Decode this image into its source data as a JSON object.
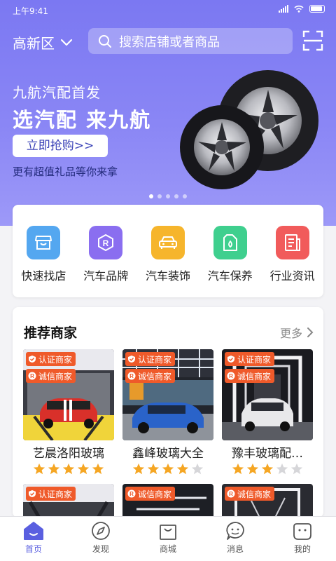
{
  "status": {
    "time": "上午9:41"
  },
  "header": {
    "city": "高新区",
    "search_placeholder": "搜索店铺或者商品"
  },
  "banner": {
    "subtitle": "九航汽配首发",
    "title": "选汽配 来九航",
    "button_label": "立即抢购>>",
    "note": "更有超值礼品等你来拿",
    "slides": 5,
    "active_slide": 0
  },
  "quick_links": [
    {
      "label": "快速找店",
      "icon": "store-icon",
      "color": "#54a7f0"
    },
    {
      "label": "汽车品牌",
      "icon": "brand-icon",
      "color": "#8a6ef0"
    },
    {
      "label": "汽车装饰",
      "icon": "car-icon",
      "color": "#f6b52c"
    },
    {
      "label": "汽车保养",
      "icon": "oil-icon",
      "color": "#3fcf8e"
    },
    {
      "label": "行业资讯",
      "icon": "news-icon",
      "color": "#f15b5b"
    }
  ],
  "recommended": {
    "title": "推荐商家",
    "more_label": "更多",
    "badges": {
      "certified": "认证商家",
      "trusted": "诚信商家"
    },
    "shops": [
      {
        "name": "艺晨洛阳玻璃",
        "rating": 5,
        "car_color": "#d9302a"
      },
      {
        "name": "鑫峰玻璃大全",
        "rating": 4,
        "car_color": "#2a63c9"
      },
      {
        "name": "豫丰玻璃配…",
        "rating": 3,
        "car_color": "#e8e8ea"
      }
    ],
    "second_row_badges": [
      "认证商家",
      "诚信商家",
      "诚信商家"
    ]
  },
  "tabs": [
    {
      "label": "首页",
      "icon": "home-icon",
      "active": true
    },
    {
      "label": "发现",
      "icon": "compass-icon",
      "active": false
    },
    {
      "label": "商城",
      "icon": "bag-icon",
      "active": false
    },
    {
      "label": "消息",
      "icon": "message-icon",
      "active": false
    },
    {
      "label": "我的",
      "icon": "profile-icon",
      "active": false
    }
  ],
  "colors": {
    "accent": "#5a5fe0",
    "badge": "#ef5a2a",
    "star": "#f5a623"
  }
}
